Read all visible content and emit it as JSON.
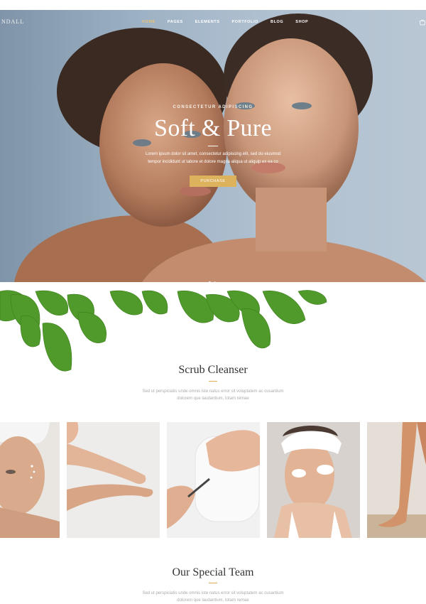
{
  "header": {
    "logo": "NDALL",
    "menu": [
      {
        "label": "HOME",
        "active": true
      },
      {
        "label": "PAGES",
        "active": false
      },
      {
        "label": "ELEMENTS",
        "active": false
      },
      {
        "label": "PORTFOLIO",
        "active": false
      },
      {
        "label": "BLOG",
        "active": false
      },
      {
        "label": "SHOP",
        "active": false
      }
    ],
    "cart_icon": "shopping-bag-icon"
  },
  "hero": {
    "kicker": "CONSECTETUR ADIPISCING",
    "title": "Soft & Pure",
    "text": "Lorem ipsum dolor sit amet, consectetur adipiscing elit, sed do eiusmod tempor incididunt ut labore et dolore magna aliqua ut aliquip ex ea co",
    "button": "PURCHASE",
    "slides": 2,
    "active_slide": 1
  },
  "section_scrub": {
    "title": "Scrub Cleanser",
    "text": "Sed ut perspiciatis unde omnis iste natus error sit voluptatem ac cusantium dolorem que laudantium, totam remae"
  },
  "gallery": {
    "items": [
      "face-cream-photo",
      "hands-lotion-photo",
      "nail-care-photo",
      "eye-patch-photo",
      "legs-photo"
    ]
  },
  "section_team": {
    "title": "Our Special Team",
    "text": "Sed ut perspiciatis unde omnis iste natus error sit voluptatem ac cusantium dolorem que laudantium, totam remae"
  },
  "colors": {
    "accent": "#dcb25c",
    "nav_active": "#e8c27a",
    "leaf": "#4f9a2a"
  }
}
